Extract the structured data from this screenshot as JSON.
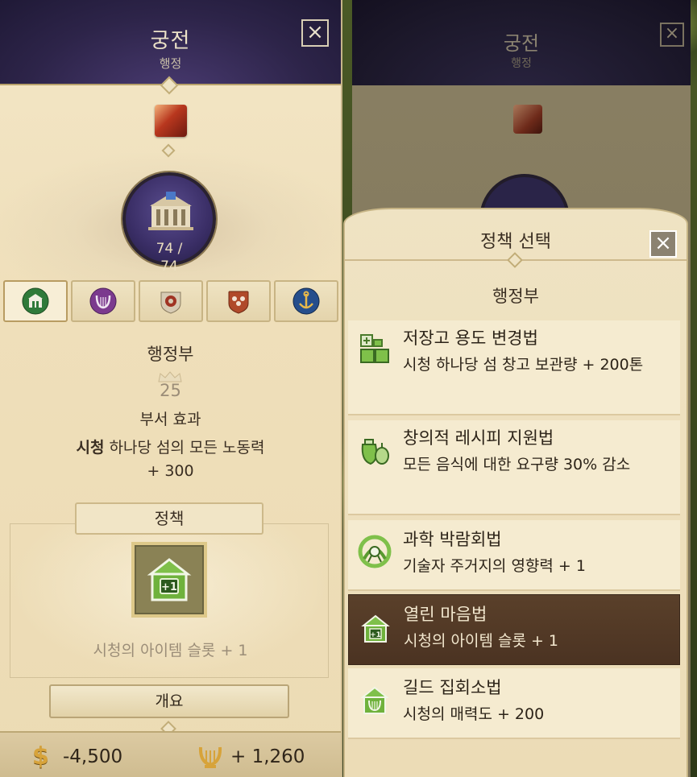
{
  "palace": {
    "title": "궁전",
    "subtitle": "행정",
    "close_label": "×",
    "building_count": "74 /",
    "building_count_total": "74",
    "tabs": [
      {
        "name": "administration",
        "icon": "town-hall-icon",
        "color": "#2f7a3a"
      },
      {
        "name": "culture",
        "icon": "lyre-icon",
        "color": "#7b3a8e"
      },
      {
        "name": "industry",
        "icon": "gear-icon",
        "color": "#a03424"
      },
      {
        "name": "society",
        "icon": "people-icon",
        "color": "#b04a2a"
      },
      {
        "name": "navy",
        "icon": "anchor-icon",
        "color": "#254e8c"
      }
    ],
    "department": "행정부",
    "level": "25",
    "effect_title": "부서 효과",
    "effect_bold": "시청",
    "effect_rest": " 하나당 섬의 모든 노동력",
    "effect_value": "+ 300",
    "policy_label": "정책",
    "policy_desc": "시청의 아이템 슬롯 + 1",
    "overview_button": "개요",
    "gold": "-4,500",
    "culture": "+ 1,260"
  },
  "policy_select": {
    "title": "정책 선택",
    "close_label": "×",
    "department": "행정부",
    "items": [
      {
        "name": "저장고 용도 변경법",
        "desc": "시청 하나당 섬 창고 보관량 + 200톤",
        "icon": "storage-boxes-icon",
        "selected": false
      },
      {
        "name": "창의적 레시피 지원법",
        "desc": "모든 음식에 대한 요구량 30% 감소",
        "icon": "food-ingredients-icon",
        "selected": false
      },
      {
        "name": "과학 박람회법",
        "desc": "기술자 주거지의 영향력 + 1",
        "icon": "science-fair-icon",
        "selected": false
      },
      {
        "name": "열린 마음법",
        "desc": "시청의 아이템 슬롯 + 1",
        "icon": "town-hall-plus-icon",
        "selected": true
      },
      {
        "name": "길드 집회소법",
        "desc": "시청의 매력도 + 200",
        "icon": "guild-hall-icon",
        "selected": false
      }
    ]
  }
}
